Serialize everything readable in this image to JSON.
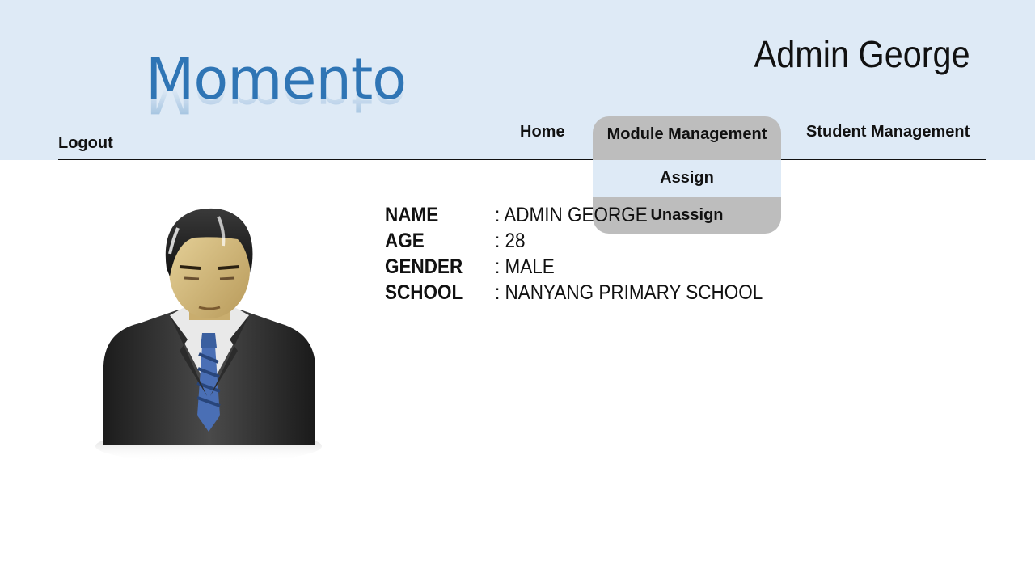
{
  "app": {
    "logo_text": "Momento",
    "admin_name": "Admin George",
    "logout_label": "Logout"
  },
  "nav": {
    "home_label": "Home",
    "module_label": "Module Management",
    "student_label": "Student Management",
    "module_menu": {
      "assign_label": "Assign",
      "unassign_label": "Unassign"
    }
  },
  "profile": {
    "fields": [
      {
        "label": "NAME",
        "value": ": ADMIN GEORGE"
      },
      {
        "label": "AGE",
        "value": ": 28"
      },
      {
        "label": "GENDER",
        "value": ": MALE"
      },
      {
        "label": "SCHOOL",
        "value": ": NANYANG PRIMARY SCHOOL"
      }
    ],
    "avatar_icon": "businessman-avatar-icon"
  },
  "colors": {
    "header_bg": "#deeaf6",
    "logo": "#2f75b5",
    "dropdown_bg": "#bdbdbd",
    "dropdown_highlight": "#deeaf6"
  }
}
